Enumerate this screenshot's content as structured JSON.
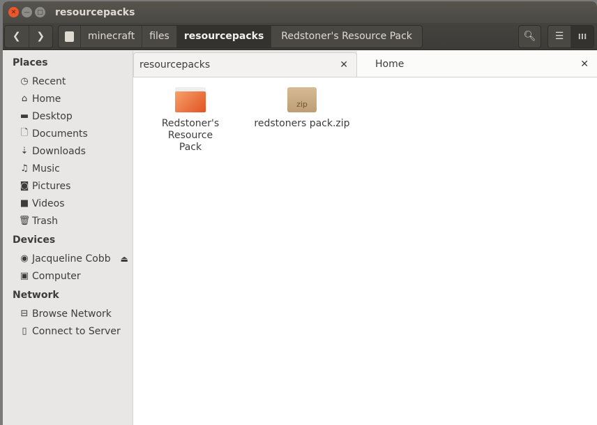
{
  "window": {
    "title": "resourcepacks"
  },
  "path": [
    "minecraft",
    "files",
    "resourcepacks",
    "Redstoner's Resource Pack"
  ],
  "path_active": "resourcepacks",
  "sidebar": {
    "places_label": "Places",
    "places": [
      {
        "label": "Recent",
        "icon": "clock-icon"
      },
      {
        "label": "Home",
        "icon": "home-icon"
      },
      {
        "label": "Desktop",
        "icon": "folder-icon"
      },
      {
        "label": "Documents",
        "icon": "document-icon"
      },
      {
        "label": "Downloads",
        "icon": "download-icon"
      },
      {
        "label": "Music",
        "icon": "music-icon"
      },
      {
        "label": "Pictures",
        "icon": "camera-icon"
      },
      {
        "label": "Videos",
        "icon": "video-icon"
      },
      {
        "label": "Trash",
        "icon": "trash-icon"
      }
    ],
    "devices_label": "Devices",
    "devices": [
      {
        "label": "Jacqueline Cobb",
        "icon": "disc-icon"
      },
      {
        "label": "Computer",
        "icon": "computer-icon"
      }
    ],
    "network_label": "Network",
    "network": [
      {
        "label": "Browse Network",
        "icon": "network-icon"
      },
      {
        "label": "Connect to Server",
        "icon": "server-icon"
      }
    ]
  },
  "tabs": [
    {
      "label": "resourcepacks"
    },
    {
      "label": "Home"
    }
  ],
  "files": [
    {
      "name": "Redstoner's Resource Pack",
      "type": "folder"
    },
    {
      "name": "redstoners pack.zip",
      "type": "zip",
      "badge": "zip"
    }
  ]
}
